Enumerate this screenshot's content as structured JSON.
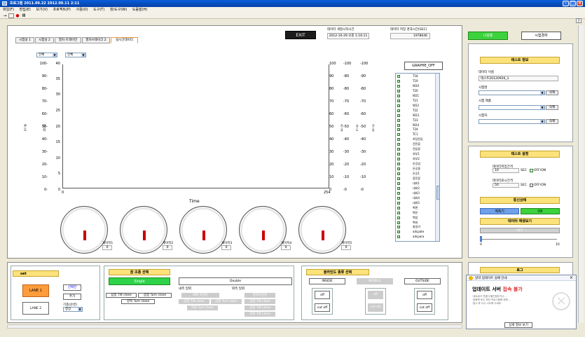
{
  "window": {
    "title": "프로그램 2011.09.22  2012.09.11 2:11",
    "min_icon": "-",
    "max_icon": "□",
    "close_icon": "×"
  },
  "menu": [
    "파일(F)",
    "편집(E)",
    "보기(V)",
    "프로젝트(P)",
    "사용(O)",
    "도구(T)",
    "창/도구(W)",
    "도움말(H)"
  ],
  "toolbar": {
    "back_icon": "→",
    "record_icon": "●",
    "pause_icon": "II",
    "help_icon": "?"
  },
  "tabs": [
    "시험설 1",
    "시험설 2",
    "열차 트래이언",
    "열차브레이크 2",
    "실시간데이터"
  ],
  "header": {
    "exit_label": "EXIT",
    "start_time_label": "데이터 개정시작시간",
    "start_time_value": "2012-10-29 오후 1:16:11",
    "elapsed_label": "데이터 저장 경과시간(SEC)",
    "elapsed_value": "1978646",
    "btn_right_1": "나감용",
    "btn_right_2": "시험경자"
  },
  "chart_area": {
    "select_1": "전체",
    "select_2": "전체",
    "x_label": "Time",
    "x_min": "0",
    "x_max": "254",
    "left_ticks_outer": [
      "100-",
      "90-",
      "80-",
      "70-",
      "60-",
      "50-",
      "40-",
      "30-",
      "20-",
      "10-",
      "0-"
    ],
    "left_ticks_inner": [
      "40",
      "35",
      "30",
      "25",
      "20",
      "15",
      "10",
      "5",
      "0"
    ],
    "right_ticks_1": [
      "100",
      "90",
      "80",
      "70",
      "60",
      "50",
      "40",
      "30",
      "20",
      "10",
      "0"
    ],
    "right_ticks_2": [
      "-100",
      "-80",
      "-80",
      "-70",
      "-60",
      "-50",
      "-40",
      "-30",
      "-20",
      "-10",
      "-0"
    ],
    "right_ticks_3": [
      "-100",
      "-90",
      "-80",
      "-70",
      "-60",
      "-50",
      "-40",
      "-30",
      "-20",
      "-10",
      "-0"
    ],
    "left_axis_label_1": "온도",
    "left_axis_label_2": "압력",
    "right_axis_label_1": "전류",
    "right_axis_label_2": "습도",
    "right_axis_label_3": "진동"
  },
  "gauges": [
    {
      "label": "게이지1",
      "value": "0"
    },
    {
      "label": "게이지2",
      "value": "0"
    },
    {
      "label": "게이지3",
      "value": "0"
    },
    {
      "label": "게이지4",
      "value": "0"
    },
    {
      "label": "게이지5",
      "value": "0"
    }
  ],
  "graph_panel": {
    "toggle_label": "GRAPHE_OFF",
    "channels": [
      "T18",
      "T19",
      "W20",
      "T20",
      "W21",
      "T21",
      "W22",
      "T22",
      "W23",
      "T23",
      "W24",
      "T24",
      "TC1",
      "#장전류",
      "전전류",
      "전압류",
      "외부1",
      "외부2",
      "온공압",
      "온공중",
      "온공1",
      "뭉전류",
      "내외1",
      "내외2",
      "내외3",
      "내외4",
      "내외5",
      "벽면",
      "벽온",
      "벽압",
      "벽외",
      "총길이",
      "adcpate",
      "adcpara"
    ]
  },
  "side": {
    "test_info_title": "테스트 정보",
    "data_name_label": "데이터 이름",
    "data_name_value": "테스트20120926_1",
    "tester_label": "시험명",
    "tester_value": "",
    "test_type_label": "시험 제품",
    "test_type_value": "",
    "operator_label": "시험자",
    "operator_value": "",
    "delete_label": "삭제",
    "settings_title": "테스트 설정",
    "save_interval_label": "데이터저장간격",
    "save_interval_value": "10",
    "sec_label": "SEC",
    "on_off_label": "OFF/ON",
    "display_interval_label": "데이터표시간격",
    "display_interval_value": "50",
    "comm_title": "통신상태",
    "measure_label": "계측기",
    "ok_label": "OK",
    "playback_title": "데이터 재생보기",
    "playback_off": "OFF",
    "slider_min": "0",
    "slider_max": "10"
  },
  "bottom": {
    "set_title": "set",
    "lane1": "LANE 1",
    "lane2": "LANE 2",
    "btn_select": "선택한",
    "btn_add": "추가",
    "order_label": "기종(순번)",
    "order_value": "정상",
    "ctrl_title": "참 조종 선택",
    "single": "Single",
    "double": "Double",
    "inner_label": "내측 일외",
    "outer_label": "외측 일외",
    "tilt_close": "삼봉 Tilt close",
    "turn_close": "삼봉 Turn close",
    "turn_close2": "양쪽 Turn close",
    "grey_buttons": [
      "내외 마감닫",
      "양쪽마감닫",
      "삼봉 Tilt close",
      "삼봉 Turn open",
      "삼봉 Tilt close",
      "하봉 Turn close",
      "중봉 Tilt close",
      "하봉 Tilt close"
    ],
    "blind_title": "블라인드 종류 선택",
    "inside": "INSIDE",
    "middle": "MIDDLE",
    "outside": "OUTSIDE",
    "off": "off",
    "cut_off": "cut off",
    "log_title": "로그"
  },
  "popup": {
    "header": "알약 업데이트 실패 안내",
    "title_prefix": "업데이트 서버 ",
    "title_emph": "접속 불가",
    "lines": [
      "·네트워크 연결이 불안정하거나 ...",
      "·방화벽 또는 보안 프로그램에 의해 ...",
      "·잠시 후 다시 시도해 주세요."
    ],
    "detail_button": "상세 정보 보기",
    "close_icon": "×"
  }
}
